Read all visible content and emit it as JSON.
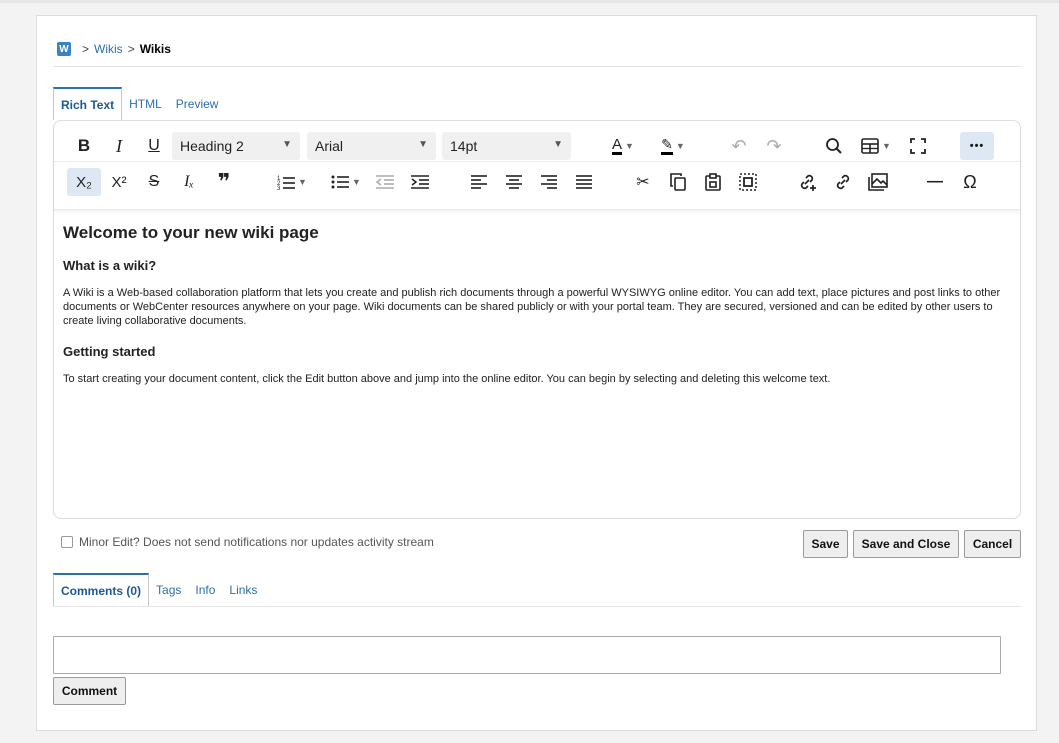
{
  "breadcrumb": {
    "logo": "W",
    "sep1": ">",
    "link": "Wikis",
    "sep2": ">",
    "current": "Wikis"
  },
  "editor_tabs": [
    {
      "label": "Rich Text",
      "active": true
    },
    {
      "label": "HTML",
      "active": false
    },
    {
      "label": "Preview",
      "active": false
    }
  ],
  "toolbar": {
    "block_format": "Heading 2",
    "font_family": "Arial",
    "font_size": "14pt",
    "icons": {
      "bold": "B",
      "italic": "I",
      "underline": "U",
      "subscript": "X₂",
      "superscript": "X²",
      "strikethrough": "S",
      "clear_format": "Iₓ",
      "blockquote": "❞",
      "text_color": "A",
      "highlight": "✎",
      "undo": "↶",
      "redo": "↷",
      "search": "⚲",
      "table": "⊞",
      "fullscreen": "⛶",
      "more": "•••",
      "numbered_list": "☰",
      "bulleted_list": "☰",
      "outdent": "⇤",
      "indent": "⇥",
      "align_left": "≡",
      "align_center": "≡",
      "align_right": "≡",
      "justify": "≡",
      "cut": "✂",
      "copy": "❐",
      "paste": "📋",
      "select_all": "⬚",
      "insert_link": "🔗",
      "link": "🔗",
      "image": "🖼",
      "horizontal_rule": "—",
      "special_char": "Ω"
    }
  },
  "document": {
    "title": "Welcome to your new wiki page",
    "section1_heading": "What is a wiki?",
    "section1_text": "A Wiki is a Web-based collaboration platform that lets you create and publish rich documents through a powerful WYSIWYG online editor. You can add text, place pictures and post links to other documents or WebCenter resources anywhere on your page. Wiki documents can be shared publicly or with your portal team. They are secured, versioned and can be edited by other users to create living collaborative documents.",
    "section2_heading": "Getting started",
    "section2_text": "To start creating your document content, click the Edit button above and jump into the online editor. You can begin by selecting and deleting this welcome text."
  },
  "minor_edit": {
    "label": "Minor Edit? Does not send notifications nor updates activity stream",
    "checked": false
  },
  "actions": {
    "save": "Save",
    "save_close": "Save and Close",
    "cancel": "Cancel"
  },
  "lower_tabs": [
    {
      "label": "Comments (0)",
      "active": true
    },
    {
      "label": "Tags",
      "active": false
    },
    {
      "label": "Info",
      "active": false
    },
    {
      "label": "Links",
      "active": false
    }
  ],
  "comment": {
    "value": "",
    "button": "Comment"
  },
  "colors": {
    "link": "#2d6fad",
    "active_button_bg": "#dee8f5",
    "text_color_bar": "#000000"
  }
}
